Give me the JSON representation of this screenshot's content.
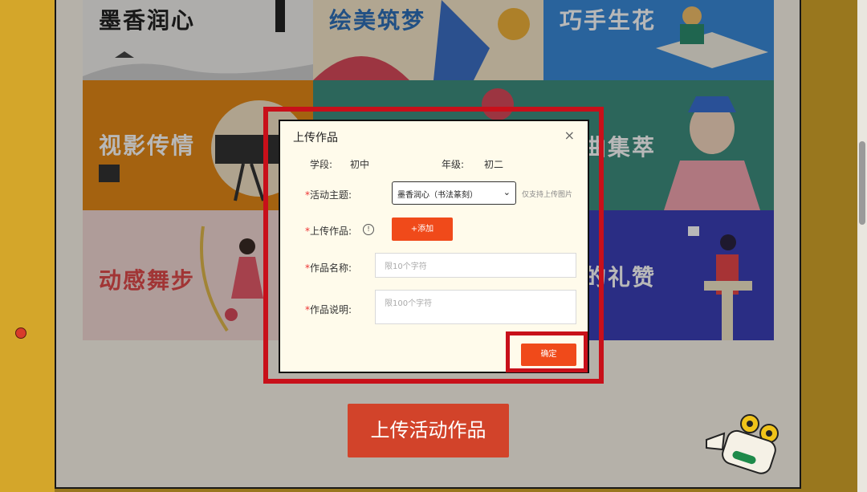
{
  "tiles": [
    {
      "title": "墨香润心",
      "bg": "#f1f0ee",
      "color": "#222"
    },
    {
      "title": "绘美筑梦",
      "bg": "#f6e7c9",
      "color": "#2f6fb8"
    },
    {
      "title": "巧手生花",
      "bg": "#3a8ad9",
      "color": "#ffffff"
    },
    {
      "title": "视影传情",
      "bg": "#e38817",
      "color": "#ffffff"
    },
    {
      "title": "",
      "bg": "#3d8e7e",
      "color": "#ffffff"
    },
    {
      "title": "曲集萃",
      "bg": "#3d8e7e",
      "color": "#ffffff"
    },
    {
      "title": "动感舞步",
      "bg": "#f3d8d5",
      "color": "#e04a4a"
    },
    {
      "title": "",
      "bg": "#f3d8d5",
      "color": "#ffffff"
    },
    {
      "title": "的礼赞",
      "bg": "#3b3fb7",
      "color": "#ffffff"
    }
  ],
  "upload_button": "上传活动作品",
  "modal": {
    "title": "上传作品",
    "close": "×",
    "stage_label": "学段:",
    "stage_value": "初中",
    "grade_label": "年级:",
    "grade_value": "初二",
    "required_mark": "*",
    "theme_label": "活动主题:",
    "theme_value": "墨香润心（书法篆刻）",
    "theme_note": "仅支持上传图片",
    "work_label": "上传作品:",
    "info_icon": "!",
    "add_button": "+添加",
    "name_label": "作品名称:",
    "name_placeholder": "限10个字符",
    "desc_label": "作品说明:",
    "desc_placeholder": "限100个字符",
    "ok_button": "确定"
  },
  "colors": {
    "accent": "#f04a1a",
    "highlight": "#c8101a",
    "background": "#d4a62a"
  }
}
